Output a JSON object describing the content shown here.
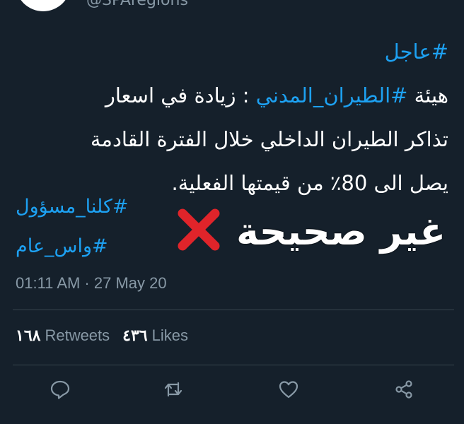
{
  "header": {
    "handle": "@SPAregions"
  },
  "tweet": {
    "hashtag_urgent": "#عاجل",
    "line1_prefix": "هيئة ",
    "line1_hashtag": "#الطيران_المدني",
    "line1_suffix": " :  زيادة في اسعار",
    "line2": "تذاكر الطيران الداخلي خلال الفترة القادمة",
    "line3": "يصل الى 80٪ من قيمتها الفعلية.",
    "tag1": "#كلنا_مسؤول",
    "tag2": "#واس_عام",
    "timestamp": "01:11 AM · 27 May 20"
  },
  "overlay": {
    "verdict": "غير صحيحة",
    "mark_color": "#e0242a"
  },
  "stats": {
    "retweets_count": "١٦٨",
    "retweets_label": "Retweets",
    "likes_count": "٤٣٦",
    "likes_label": "Likes"
  },
  "actions": {
    "reply": "reply-icon",
    "retweet": "retweet-icon",
    "like": "heart-icon",
    "share": "share-icon"
  },
  "colors": {
    "background": "#15202b",
    "link": "#1da1f2",
    "muted": "#8899a6",
    "divider": "#38444d"
  }
}
